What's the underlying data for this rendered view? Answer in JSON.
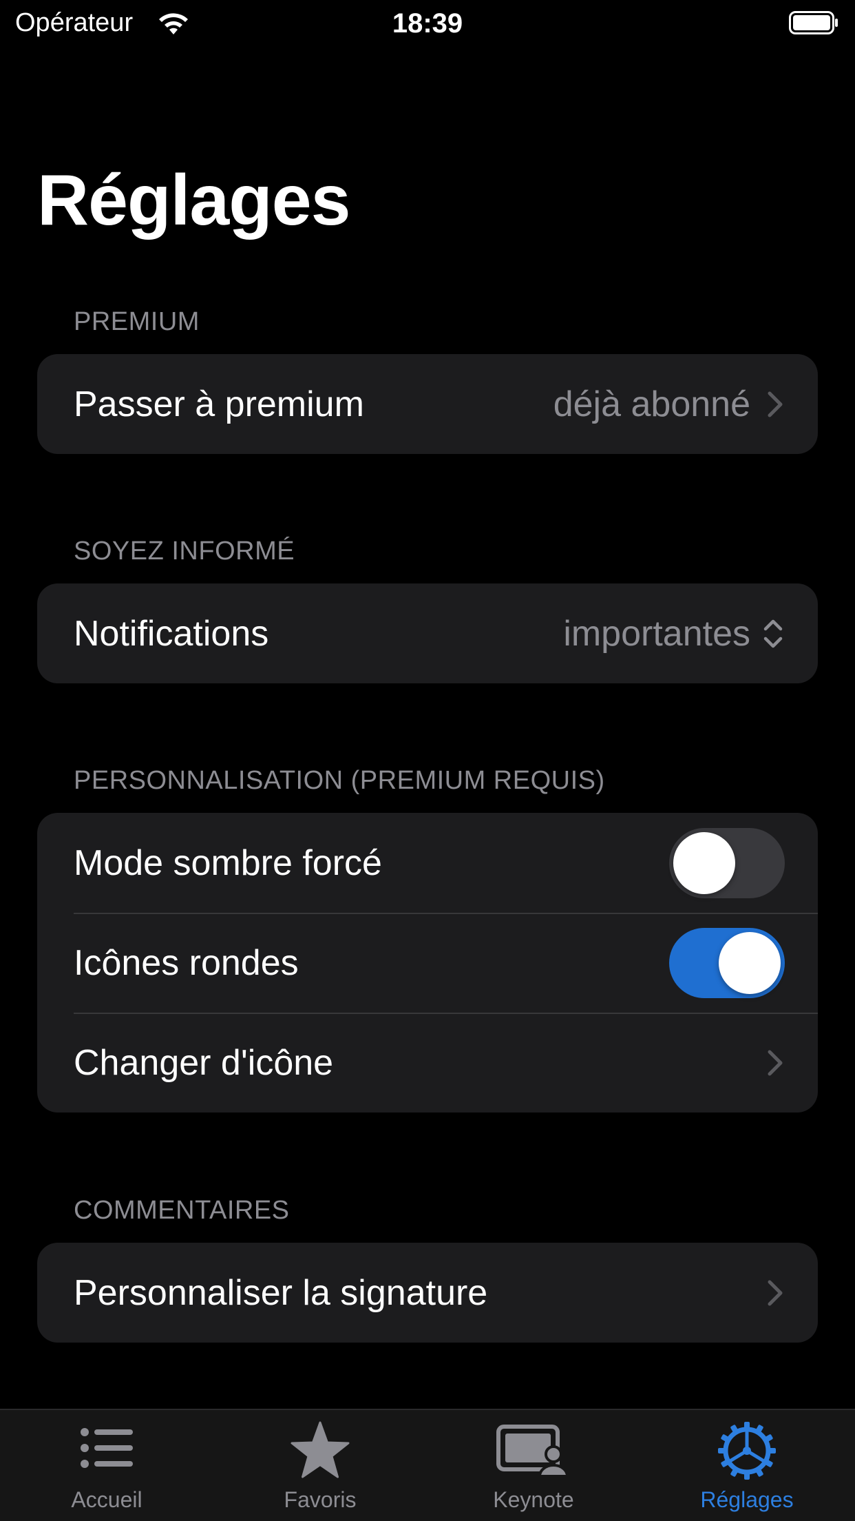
{
  "status_bar": {
    "carrier": "Opérateur",
    "time": "18:39"
  },
  "page": {
    "title": "Réglages"
  },
  "sections": {
    "premium": {
      "header": "PREMIUM",
      "rows": [
        {
          "label": "Passer à premium",
          "value": "déjà abonné"
        }
      ]
    },
    "informed": {
      "header": "SOYEZ INFORMÉ",
      "rows": [
        {
          "label": "Notifications",
          "value": "importantes"
        }
      ]
    },
    "personalisation": {
      "header": "PERSONNALISATION (PREMIUM REQUIS)",
      "rows": [
        {
          "label": "Mode sombre forcé",
          "toggle": false
        },
        {
          "label": "Icônes rondes",
          "toggle": true
        },
        {
          "label": "Changer d'icône"
        }
      ]
    },
    "comments": {
      "header": "COMMENTAIRES",
      "rows": [
        {
          "label": "Personnaliser la signature"
        }
      ]
    }
  },
  "tab_bar": {
    "tabs": [
      {
        "label": "Accueil",
        "icon": "list-icon"
      },
      {
        "label": "Favoris",
        "icon": "star-icon"
      },
      {
        "label": "Keynote",
        "icon": "keynote-icon"
      },
      {
        "label": "Réglages",
        "icon": "gear-icon",
        "active": true
      }
    ]
  },
  "colors": {
    "accent": "#1f6fd1",
    "tab_active": "#2d7fe0",
    "cell_bg": "#1c1c1e",
    "secondary_text": "#8d8d93"
  }
}
